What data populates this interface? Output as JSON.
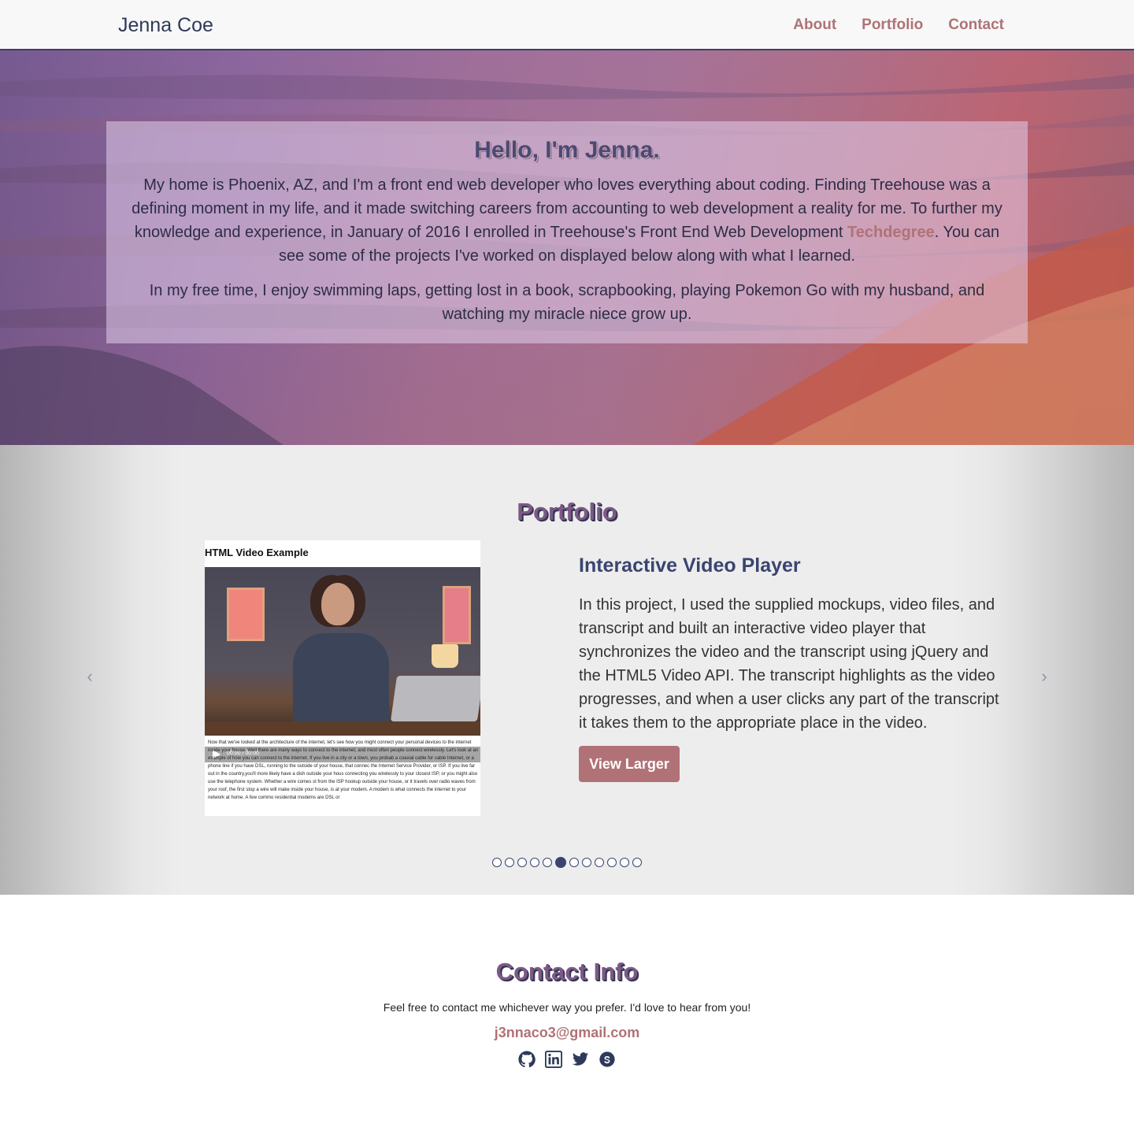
{
  "nav": {
    "brand": "Jenna Coe",
    "links": [
      "About",
      "Portfolio",
      "Contact"
    ]
  },
  "hero": {
    "title": "Hello, I'm Jenna.",
    "para1_before": "My home is Phoenix, AZ, and I'm a front end web developer who loves everything about coding. Finding Treehouse was a defining moment in my life, and it made switching careers from accounting to web development a reality for me. To further my knowledge and experience, in January of 2016 I enrolled in Treehouse's Front End Web Development ",
    "para1_link": "Techdegree",
    "para1_after": ". You can see some of the projects I've worked on displayed below along with what I learned.",
    "para2": "In my free time, I enjoy swimming laps, getting lost in a book, scrapbooking, playing Pokemon Go with my husband, and watching my miracle niece grow up."
  },
  "portfolio": {
    "title": "Portfolio",
    "slide": {
      "screenshot_heading": "HTML Video Example",
      "screenshot_time": "00:00 / 00:00",
      "screenshot_transcript": "Now that we've looked at the architecture of the internet, let's see how you might connect your personal devices to the internet inside your house. Well there are many ways to connect to the internet, and most often people connect wirelessly. Let's look at an example of how you can connect to the internet. If you live in a city or a town, you probab a coaxial cable for cable Internet, or a phone line if you have DSL, running to the outside of your house, that connec the Internet Service Provider, or ISP. If you live far out in the country,you'll more likely have a dish outside your hous connecting you wirelessly to your closest ISP, or you might also use the telephone system. Whether a wire comes st from the ISP hookup outside your house, or it travels over radio waves from your roof, the first stop a wire will make inside your house, is at your modem. A modem is what connects the internet to your network at home. A few commo residential modems are DSL or",
      "title": "Interactive Video Player",
      "description": "In this project, I used the supplied mockups, video files, and transcript and built an interactive video player that synchronizes the video and the transcript using jQuery and the HTML5 Video API. The transcript highlights as the video progresses, and when a user clicks any part of the transcript it takes them to the appropriate place in the video.",
      "button": "View Larger"
    },
    "arrows": {
      "prev": "‹",
      "next": "›"
    },
    "indicator_count": 12,
    "active_indicator": 6
  },
  "contact": {
    "title": "Contact Info",
    "text": "Feel free to contact me whichever way you prefer. I'd love to hear from you!",
    "email": "j3nnaco3@gmail.com",
    "socials": [
      "github-icon",
      "linkedin-icon",
      "twitter-icon",
      "skype-icon"
    ]
  },
  "colors": {
    "accent": "#b07276",
    "navy": "#3a4470",
    "title_purple": "#7c5a86"
  }
}
